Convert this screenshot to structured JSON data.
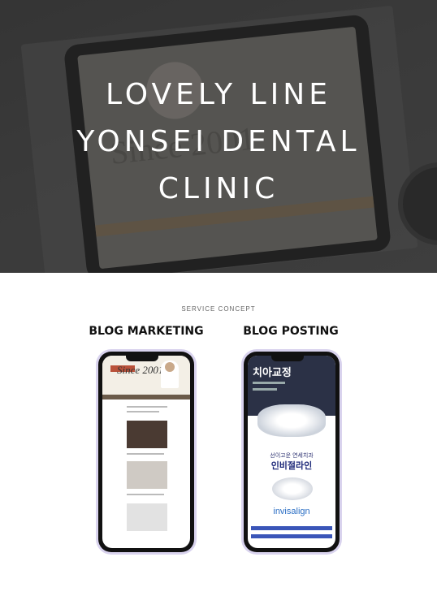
{
  "hero": {
    "title_lines": [
      "LOVELY LINE",
      "YONSEI DENTAL",
      "CLINIC"
    ],
    "background_text": "Since 2001"
  },
  "section": {
    "kicker": "SERVICE CONCEPT",
    "columns": [
      {
        "title": "BLOG MARKETING",
        "screen_text": "Since 2001"
      },
      {
        "title": "BLOG POSTING",
        "heading": "치아교정",
        "subtitle": "선이고운 연세치과",
        "headline": "인비절라인",
        "brand": "invisalign"
      }
    ]
  }
}
